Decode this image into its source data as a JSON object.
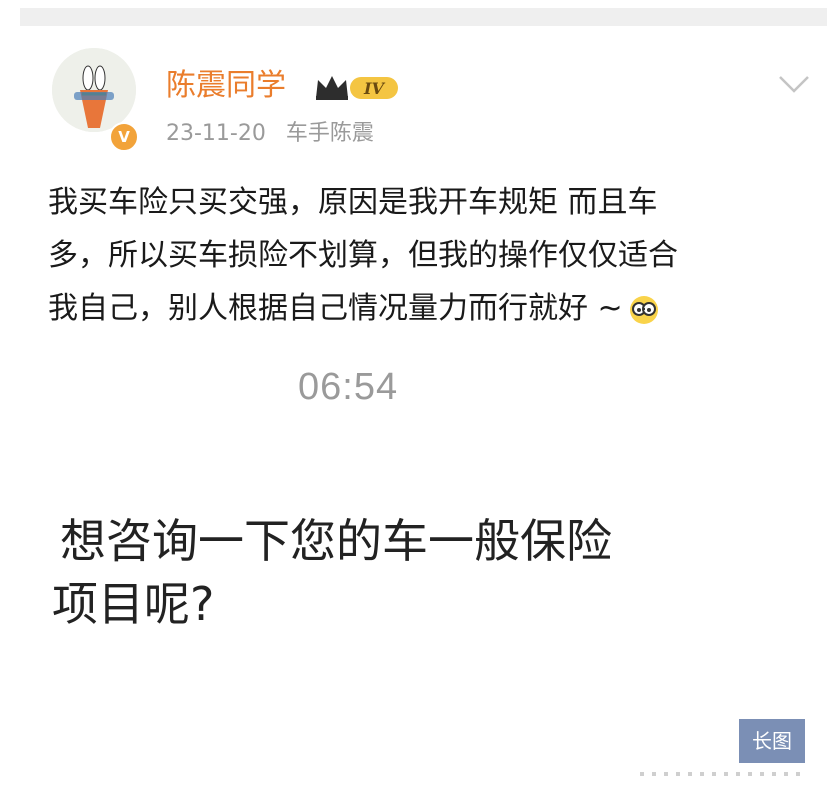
{
  "post": {
    "username": "陈震同学",
    "vip_level": "IV",
    "date": "23-11-20",
    "source": "车手陈震",
    "verified": "V",
    "text_lines": [
      "我买车险只买交强，原因是我开车规矩 而且车",
      "多，所以买车损险不划算，但我的操作仅仅适合",
      "我自己，别人根据自己情况量力而行就好 ~"
    ],
    "emoji": "glasses-emoji"
  },
  "screenshot": {
    "time": "06:54",
    "message_lines": [
      "想咨询一下您的车一般保险",
      "项目呢?"
    ]
  },
  "badge": {
    "long_image": "长图"
  },
  "icons": {
    "chevron": "chevron-down-icon",
    "verified": "verified-icon",
    "crown": "crown-icon"
  },
  "colors": {
    "username": "#ea7d2c",
    "meta": "#9a9a9a",
    "text": "#1a1a1a",
    "badge_bg": "#7b8fb5",
    "verified": "#f2a33a"
  }
}
